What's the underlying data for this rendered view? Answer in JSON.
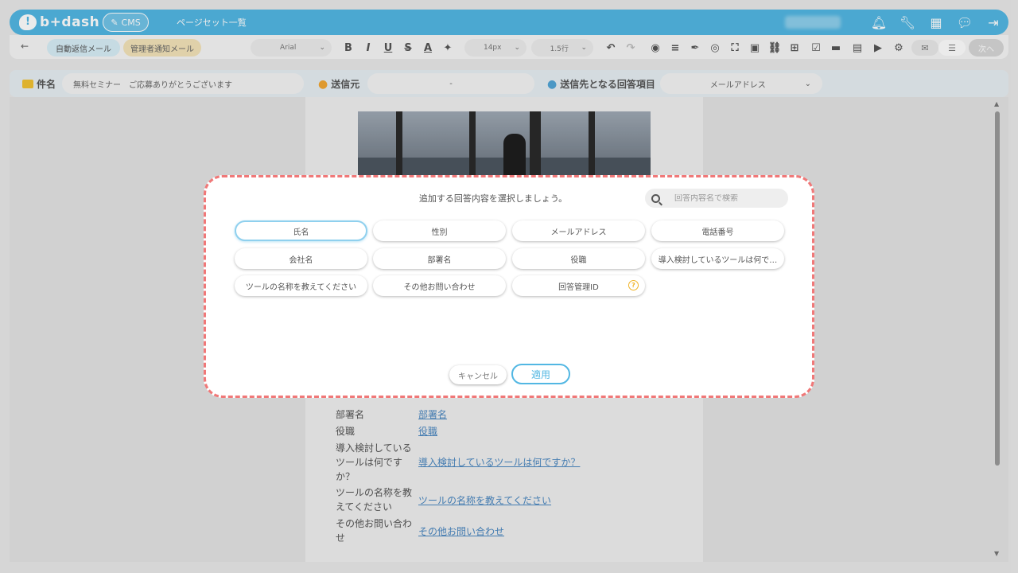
{
  "app": {
    "logo_text": "b+dash",
    "cms_label": "CMS",
    "page_title": "ページセット一覧"
  },
  "topbar_icons": [
    "bell-icon",
    "wrench-icon",
    "grid-icon",
    "chat-icon",
    "logout-icon"
  ],
  "toolbar": {
    "tab_auto_reply": "自動返信メール",
    "tab_admin_notice": "管理者通知メール",
    "font_family": "Arial",
    "font_size": "14px",
    "line_height": "1.5行",
    "next_label": "次へ"
  },
  "subject_row": {
    "subject_label": "件名",
    "subject_value": "無料セミナー　ご応募ありがとうございます",
    "sender_label": "送信元",
    "sender_value": "-",
    "recipient_label": "送信先となる回答項目",
    "recipient_value": "メールアドレス"
  },
  "body_rows": [
    {
      "label": "部署名",
      "link": "部署名"
    },
    {
      "label": "役職",
      "link": "役職"
    },
    {
      "label": "導入検討している\nツールは何です\nか？",
      "link": "導入検討しているツールは何ですか？"
    },
    {
      "label": "ツールの名称を教\nえてください",
      "link": "ツールの名称を教えてください"
    },
    {
      "label": "その他お問い合わ\nせ",
      "link": "その他お問い合わせ"
    }
  ],
  "modal": {
    "title": "追加する回答内容を選択しましょう。",
    "search_placeholder": "回答内容名で検索",
    "chips": [
      {
        "label": "氏名",
        "selected": true
      },
      {
        "label": "性別",
        "selected": false
      },
      {
        "label": "メールアドレス",
        "selected": false
      },
      {
        "label": "電話番号",
        "selected": false
      },
      {
        "label": "会社名",
        "selected": false
      },
      {
        "label": "部署名",
        "selected": false
      },
      {
        "label": "役職",
        "selected": false
      },
      {
        "label": "導入検討しているツールは何で…",
        "selected": false
      },
      {
        "label": "ツールの名称を教えてください",
        "selected": false
      },
      {
        "label": "その他お問い合わせ",
        "selected": false
      },
      {
        "label": "回答管理ID",
        "selected": false,
        "help": "?"
      }
    ],
    "cancel_label": "キャンセル",
    "apply_label": "適用"
  }
}
